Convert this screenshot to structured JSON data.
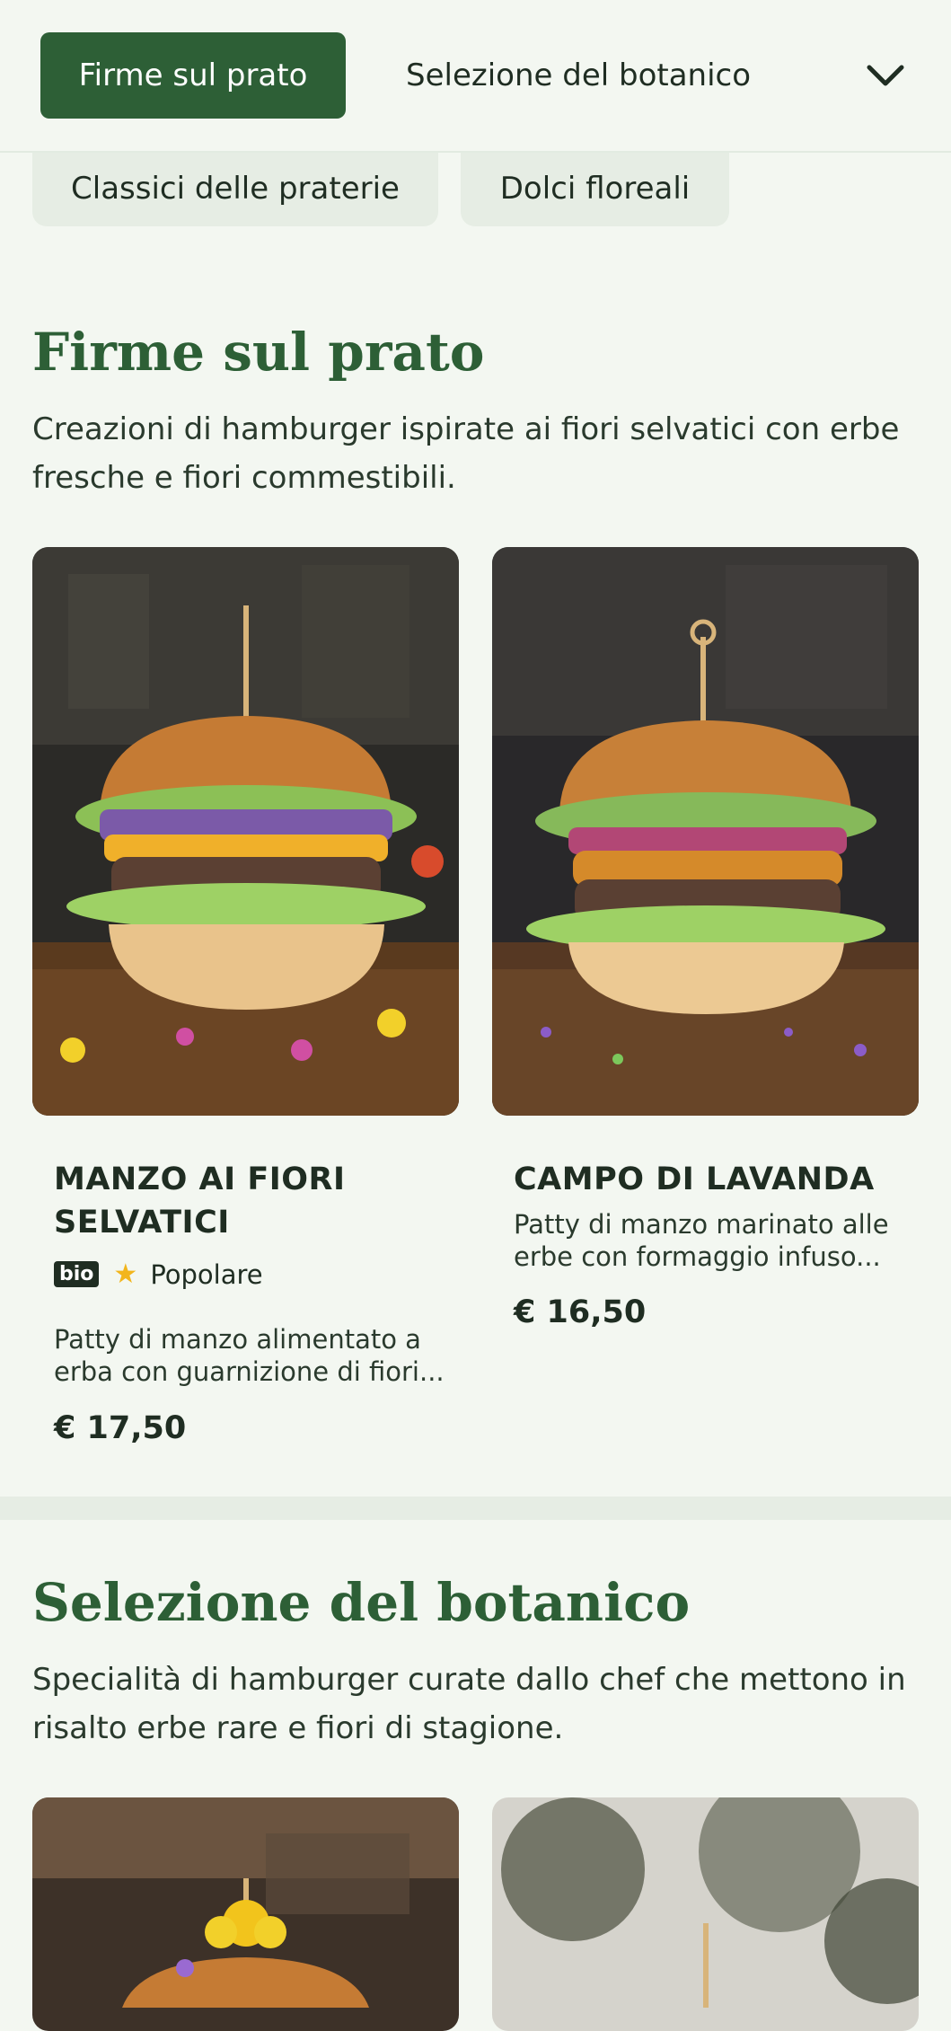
{
  "nav": {
    "active_tab": "Firme sul prato",
    "next_tab": "Selezione del botanico",
    "chips": [
      "Classici delle praterie",
      "Dolci floreali"
    ]
  },
  "sections": [
    {
      "title": "Firme sul prato",
      "description": "Creazioni di hamburger ispirate ai fiori selvatici con erbe fresche e fiori commestibili.",
      "items": [
        {
          "title": "MANZO AI FIORI SELVATICI",
          "badge": "bio",
          "tag": "Popolare",
          "description": "Patty di manzo alimentato a erba con guarnizione di fiori...",
          "price": "€ 17,50"
        },
        {
          "title": "CAMPO DI LAVANDA",
          "description": "Patty di manzo marinato alle erbe con formaggio infuso...",
          "price": "€ 16,50"
        }
      ]
    },
    {
      "title": "Selezione del botanico",
      "description": "Specialità di hamburger curate dallo chef che mettono in risalto erbe rare e fiori di stagione."
    }
  ],
  "colors": {
    "brand_green": "#2d5f36",
    "background": "#f3f7f1",
    "chip": "#e6ede4",
    "star": "#f2b51c"
  },
  "icons": [
    "chevron-down-icon",
    "star-icon"
  ]
}
